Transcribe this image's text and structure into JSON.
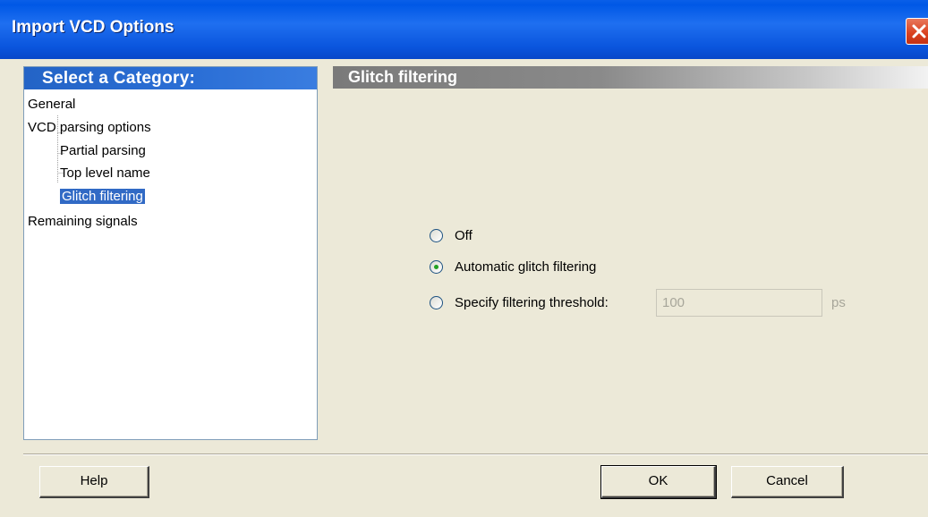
{
  "window": {
    "title": "Import VCD Options"
  },
  "sidebar": {
    "header": "Select a Category:",
    "items": [
      {
        "label": "General"
      },
      {
        "label": "VCD parsing options"
      },
      {
        "label": "Partial parsing"
      },
      {
        "label": "Top level name"
      },
      {
        "label": "Glitch filtering",
        "selected": true
      },
      {
        "label": "Remaining signals"
      }
    ]
  },
  "panel": {
    "header": "Glitch filtering",
    "options": [
      {
        "label": "Off",
        "checked": false
      },
      {
        "label": "Automatic glitch filtering",
        "checked": true
      },
      {
        "label": "Specify filtering threshold:",
        "checked": false
      }
    ],
    "threshold": {
      "value": "100",
      "unit": "ps"
    }
  },
  "buttons": {
    "help": "Help",
    "ok": "OK",
    "cancel": "Cancel"
  }
}
